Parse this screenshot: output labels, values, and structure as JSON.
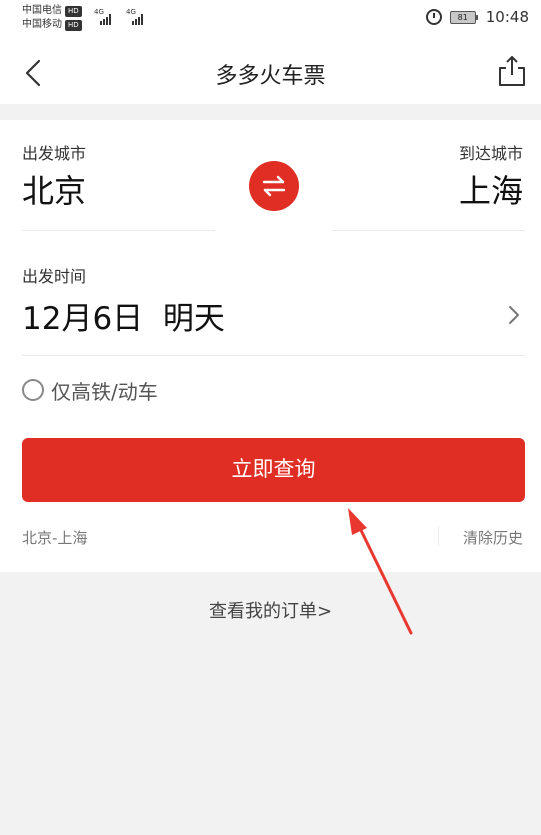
{
  "status_bar": {
    "carrier1": "中国电信",
    "carrier2": "中国移动",
    "hd_badge": "HD",
    "network1": "4G",
    "network2": "4G",
    "battery_level": "81",
    "time": "10:48"
  },
  "nav": {
    "title": "多多火车票"
  },
  "search": {
    "departure_label": "出发城市",
    "departure_city": "北京",
    "arrival_label": "到达城市",
    "arrival_city": "上海",
    "date_label": "出发时间",
    "date_value": "12月6日  明天",
    "high_speed_only_label": "仅高铁/动车",
    "high_speed_only_checked": false,
    "query_button": "立即查询"
  },
  "history": {
    "items": [
      "北京-上海"
    ],
    "clear_label": "清除历史"
  },
  "footer": {
    "my_orders_label": "查看我的订单>"
  },
  "colors": {
    "accent": "#e02e24",
    "annotation_arrow": "#e8382f"
  }
}
